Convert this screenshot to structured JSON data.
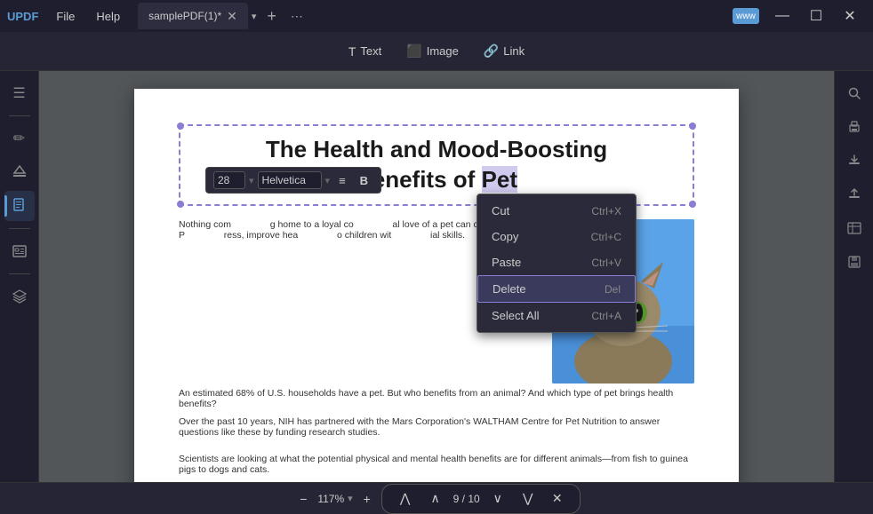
{
  "titleBar": {
    "logo": "UPDF",
    "nav": [
      "File",
      "Help"
    ],
    "tab": {
      "label": "samplePDF(1)*",
      "dropdown": "▾"
    },
    "controls": {
      "minimize": "—",
      "maximize": "☐",
      "close": "✕"
    }
  },
  "toolbar": {
    "text_label": "Text",
    "image_label": "Image",
    "link_label": "Link",
    "text_icon": "T",
    "image_icon": "🖼",
    "link_icon": "🔗"
  },
  "formatBar": {
    "size": "28",
    "font": "Helvetica",
    "align_icon": "≡",
    "bold_icon": "B"
  },
  "contextMenu": {
    "items": [
      {
        "label": "Cut",
        "shortcut": "Ctrl+X"
      },
      {
        "label": "Copy",
        "shortcut": "Ctrl+C"
      },
      {
        "label": "Paste",
        "shortcut": "Ctrl+V"
      },
      {
        "label": "Delete",
        "shortcut": "Del"
      },
      {
        "label": "Select All",
        "shortcut": "Ctrl+A"
      }
    ]
  },
  "pdf": {
    "title_part1": "The Health and Mood-Boosting",
    "title_part2": "Benefits of Pet",
    "title_highlight": "Pet",
    "body_p1": "Nothing com                g home to a loyal co                al love of a pet can company. P                ress, improve hea                o children wit                ial skills.",
    "body_p2": "An estimated 68% of U.S. households have a pet. But who benefits from an animal? And which type of pet brings health benefits?",
    "body_p3": "Over the past 10 years, NIH has partnered with the Mars Corporation's WALTHAM Centre for Pet Nutrition to answer questions like these by funding research studies.",
    "body_bottom": "Scientists are looking at what the potential physical and mental health benefits are for different animals—from fish to guinea pigs to dogs and cats."
  },
  "bottomBar": {
    "zoom": "117%",
    "page_current": "9",
    "page_total": "10",
    "page_display": "9 / 10"
  },
  "sidebar": {
    "left_items": [
      {
        "icon": "☰",
        "name": "menu-icon"
      },
      {
        "icon": "—",
        "name": "divider-icon"
      },
      {
        "icon": "✏️",
        "name": "edit-icon"
      },
      {
        "icon": "🖊",
        "name": "markup-icon"
      },
      {
        "icon": "📄",
        "name": "page-icon",
        "active": true
      },
      {
        "icon": "—",
        "name": "divider2-icon"
      },
      {
        "icon": "📋",
        "name": "form-icon"
      },
      {
        "icon": "—",
        "name": "divider3-icon"
      },
      {
        "icon": "⚙",
        "name": "layer-icon"
      }
    ],
    "right_items": [
      {
        "icon": "🔍",
        "name": "search-right-icon"
      },
      {
        "icon": "🖨",
        "name": "print-icon"
      },
      {
        "icon": "📥",
        "name": "import-icon"
      },
      {
        "icon": "📤",
        "name": "export-icon"
      },
      {
        "icon": "📧",
        "name": "email-icon"
      },
      {
        "icon": "💾",
        "name": "save-icon"
      }
    ]
  }
}
